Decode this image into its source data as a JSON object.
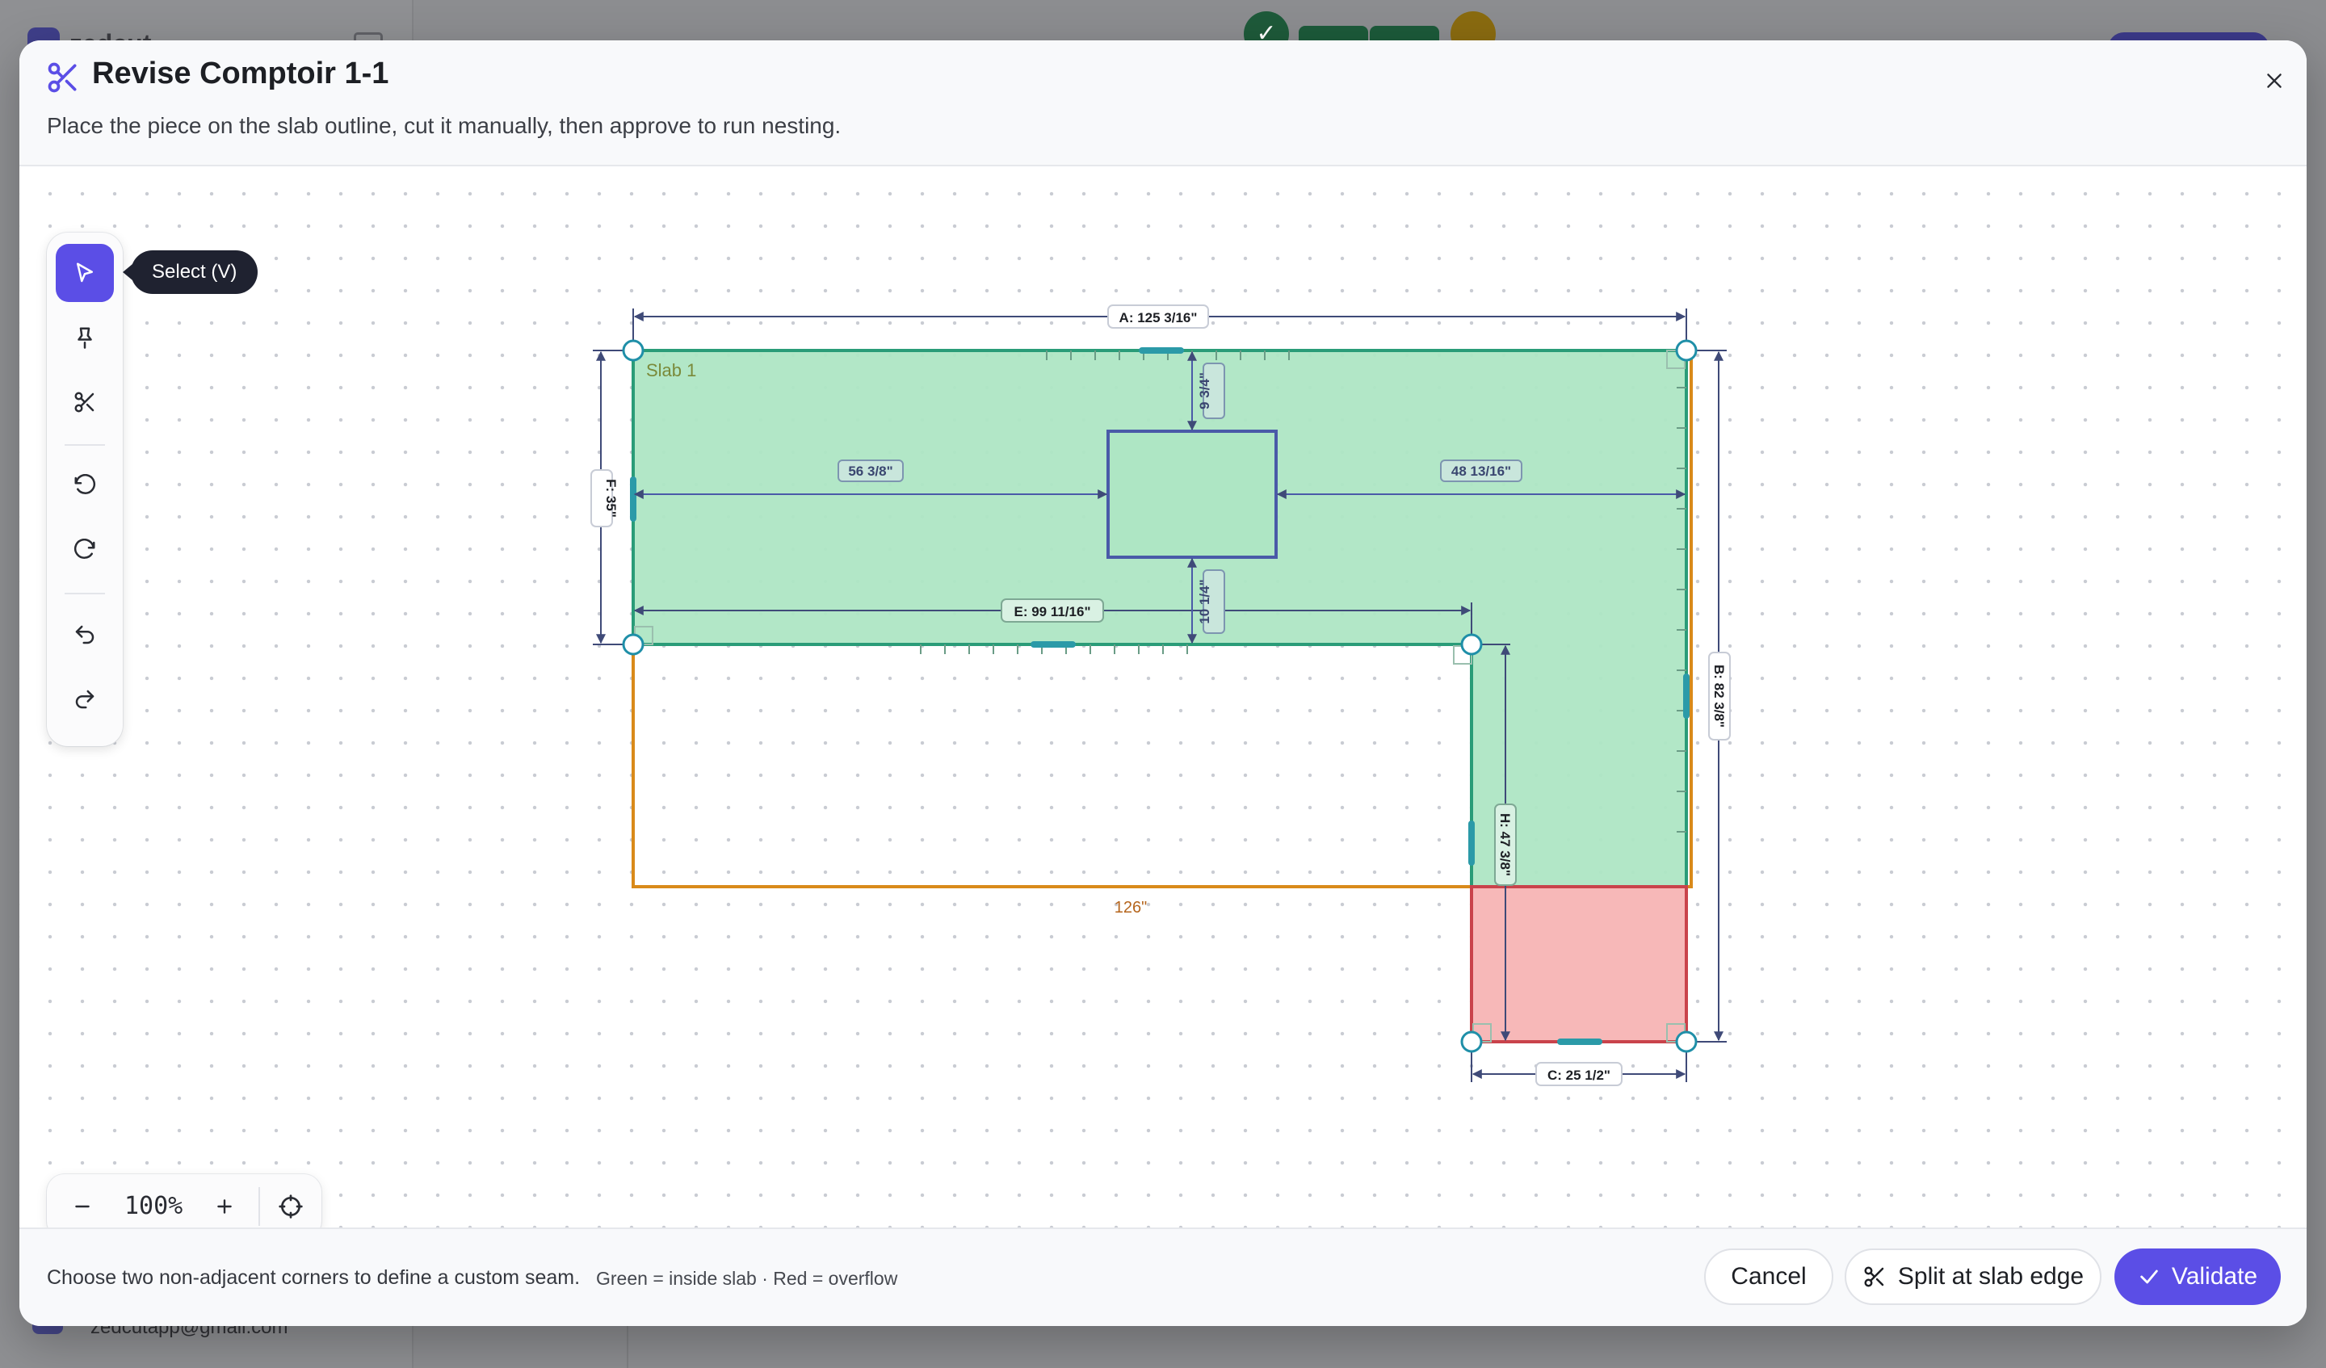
{
  "background": {
    "app_name": "zedcut",
    "user_email": "zedcutapp@gmail.com"
  },
  "modal": {
    "title": "Revise Comptoir 1-1",
    "subtitle": "Place the piece on the slab outline, cut it manually, then approve to run nesting."
  },
  "toolbar": {
    "tooltip": "Select (V)",
    "tools": [
      {
        "icon": "pointer-icon",
        "active": true
      },
      {
        "icon": "pin-icon"
      },
      {
        "icon": "scissors-icon"
      },
      {
        "icon": "rotate-ccw-icon"
      },
      {
        "icon": "rotate-cw-icon"
      },
      {
        "icon": "undo-icon"
      },
      {
        "icon": "redo-icon"
      }
    ]
  },
  "canvas": {
    "slab_label": "Slab 1",
    "slab_width_label": "126\"",
    "dimensions": {
      "A": "A: 125 3/16\"",
      "B": "B: 82 3/8\"",
      "C": "C: 25 1/2\"",
      "E": "E: 99 11/16\"",
      "F": "F: 35\"",
      "H": "H: 47 3/8\"",
      "cutout_left": "56 3/8\"",
      "cutout_right": "48 13/16\"",
      "cutout_top": "9 3/4\"",
      "cutout_bottom": "10 1/4\""
    },
    "colors": {
      "inside": "#aee6c4",
      "overflow": "#f7b8b8",
      "slab_outline": "#d98a1a",
      "piece_outline": "#2a9c78",
      "dim_line": "#3f4a78"
    }
  },
  "zoom": {
    "minus": "−",
    "value": "100%",
    "plus": "+"
  },
  "footer": {
    "hint": "Choose two non-adjacent corners to define a custom seam.",
    "legend": "Green = inside slab · Red = overflow",
    "cancel": "Cancel",
    "split": "Split at slab edge",
    "validate": "Validate"
  }
}
